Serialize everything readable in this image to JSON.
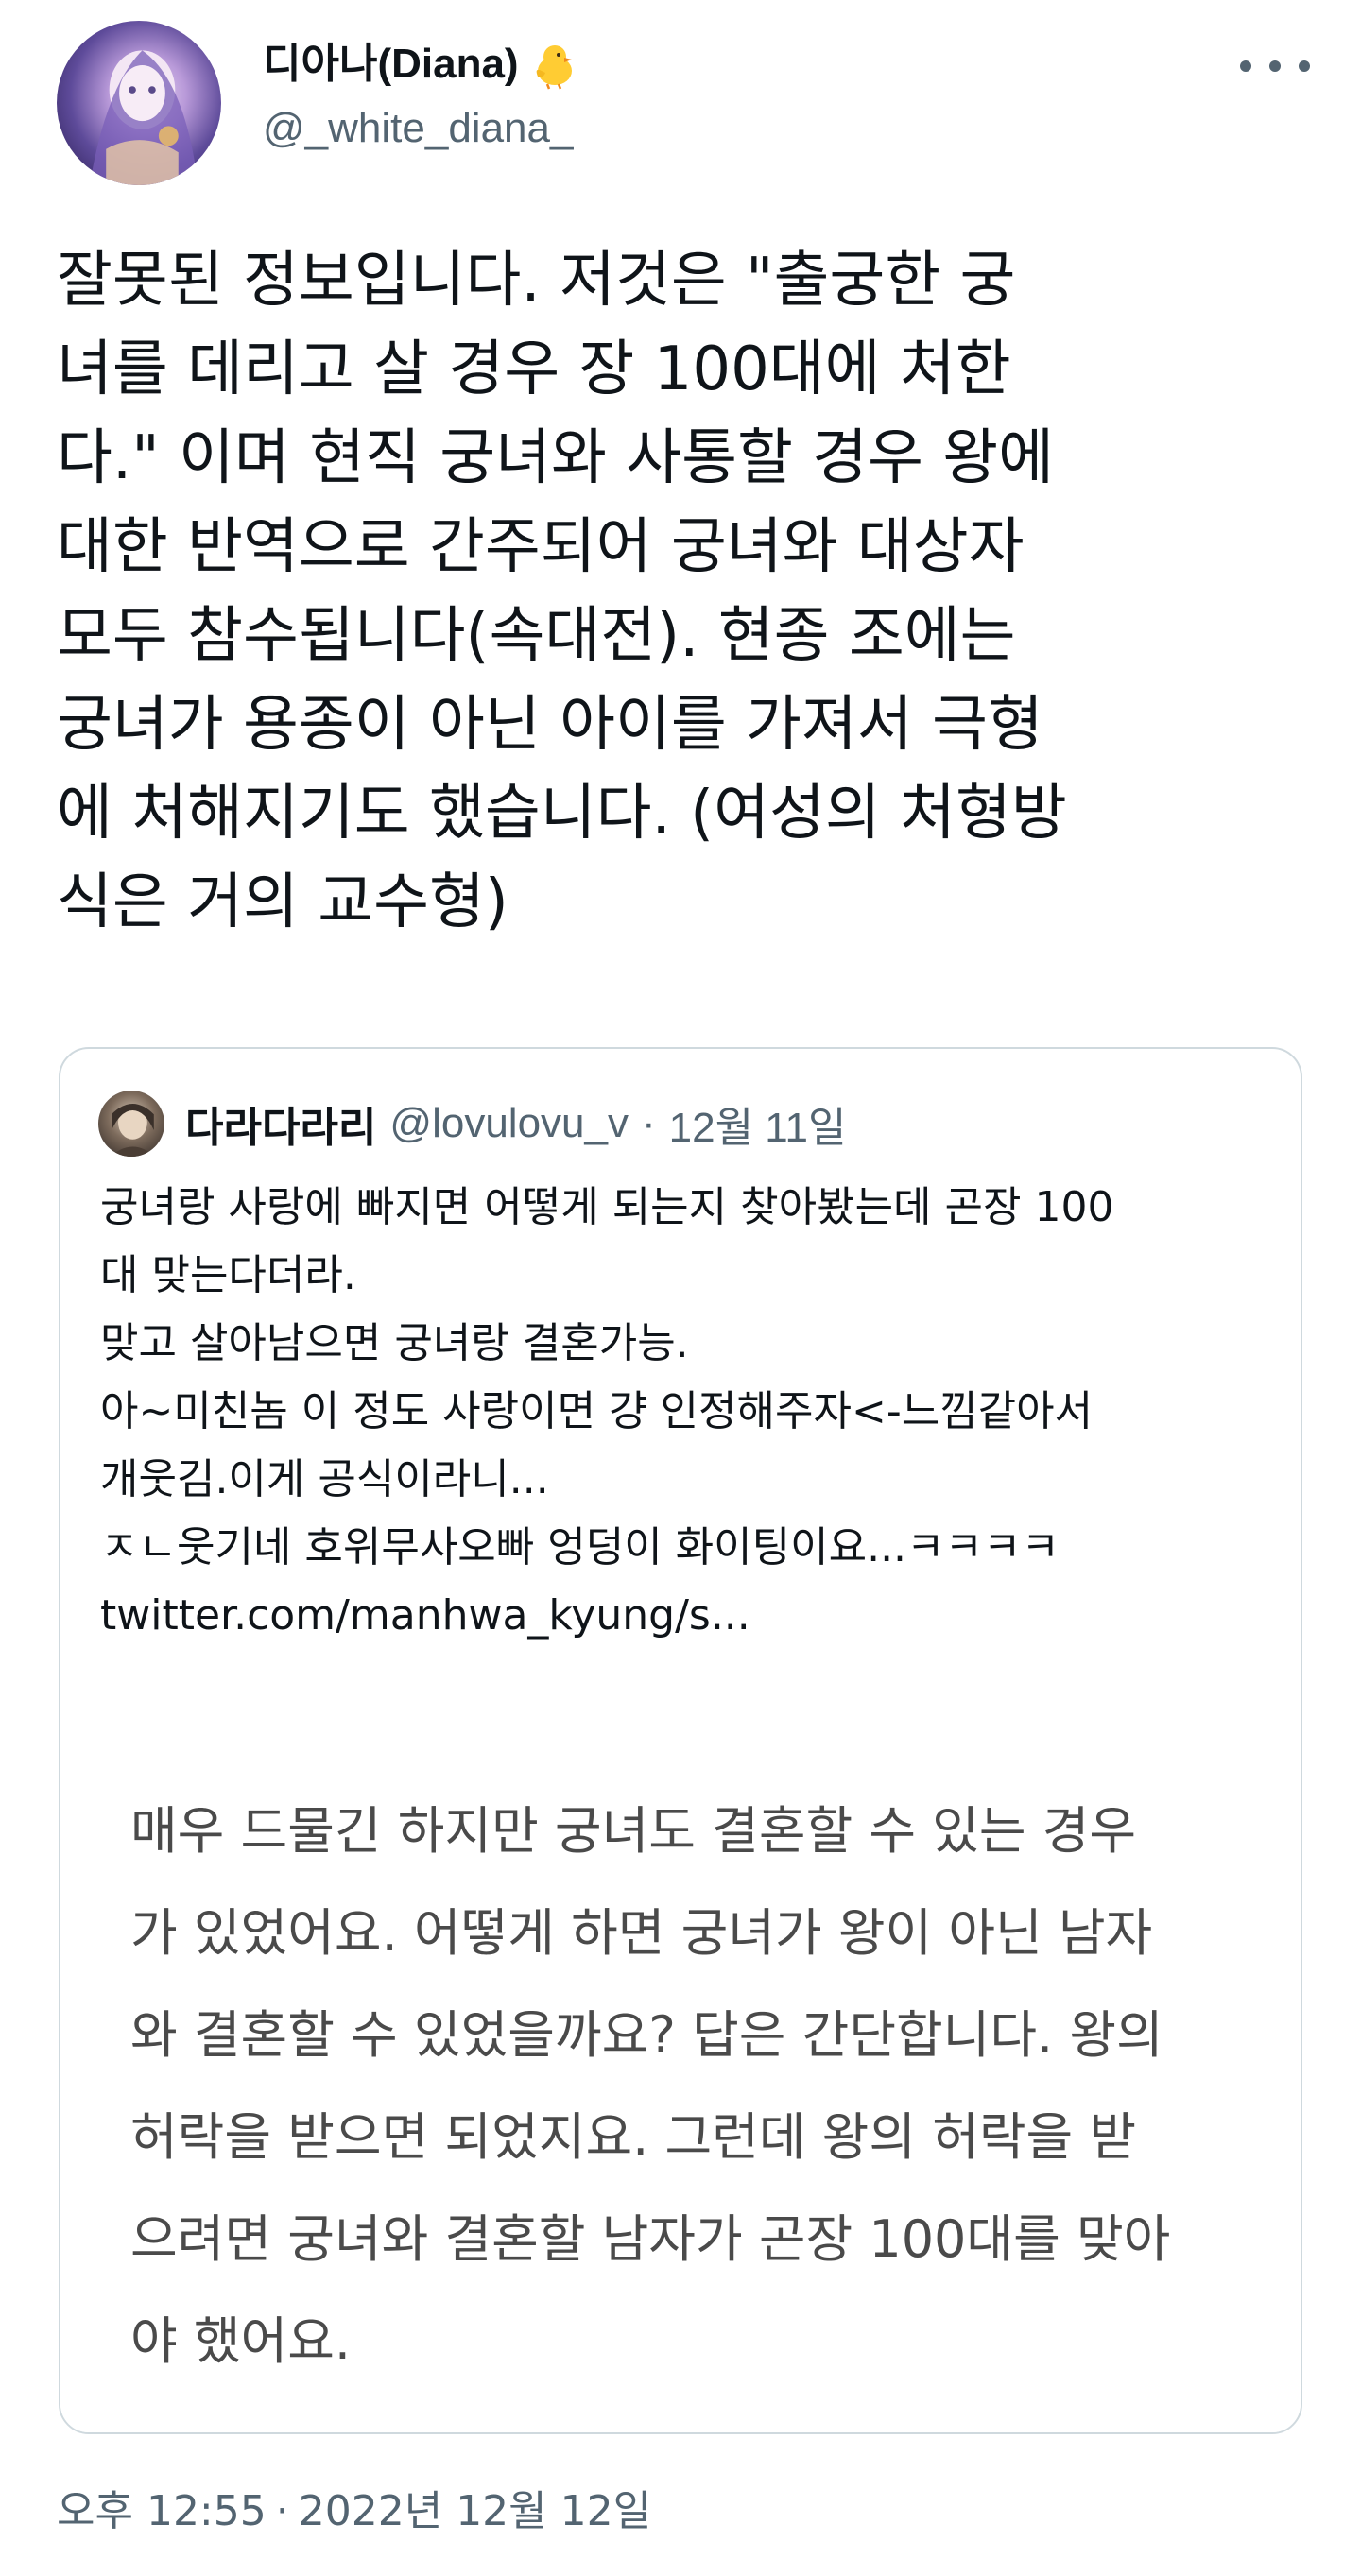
{
  "tweet": {
    "display_name": "디아나(Diana)",
    "handle": "@_white_diana_",
    "text": "잘못된 정보입니다. 저것은 \"출궁한 궁\n녀를 데리고 살 경우 장 100대에 처한\n다.\" 이며 현직 궁녀와 사통할 경우 왕에\n대한 반역으로 간주되어 궁녀와 대상자\n모두 참수됩니다(속대전). 현종 조에는\n궁녀가 용종이 아닌 아이를 가져서 극형\n에 처해지기도 했습니다. (여성의 처형방\n식은 거의 교수형)",
    "time": "오후 12:55",
    "separator": "·",
    "date": "2022년 12월 12일"
  },
  "quoted_tweet": {
    "display_name": "다라다라리",
    "handle": "@lovulovu_v",
    "separator": "·",
    "date": "12월 11일",
    "text": "궁녀랑 사랑에 빠지면 어떻게 되는지 찾아봤는데 곤장 100\n대 맞는다더라.\n맞고 살아남으면 궁녀랑 결혼가능.\n아~미친놈 이 정도 사랑이면 걍 인정해주자<-느낌같아서\n개웃김.이게 공식이라니...\nㅈㄴ웃기네 호위무사오빠 엉덩이 화이팅이요...ㅋㅋㅋㅋ\ntwitter.com/manhwa_kyung/s...",
    "image_text": "매우 드물긴 하지만 궁녀도 결혼할 수 있는 경우\n가 있었어요. 어떻게 하면 궁녀가 왕이 아닌 남자\n와 결혼할 수 있었을까요? 답은 간단합니다. 왕의\n허락을 받으면 되었지요. 그런데 왕의 허락을 받\n으려면 궁녀와 결혼할 남자가 곤장 100대를 맞아\n야 했어요."
  },
  "icons": {
    "more": "more-options-icon",
    "badge": "chick-emoji-icon"
  },
  "colors": {
    "text_primary": "#0f1419",
    "text_secondary": "#536471",
    "border": "#cfd9de",
    "image_text": "#4a4a4a"
  }
}
